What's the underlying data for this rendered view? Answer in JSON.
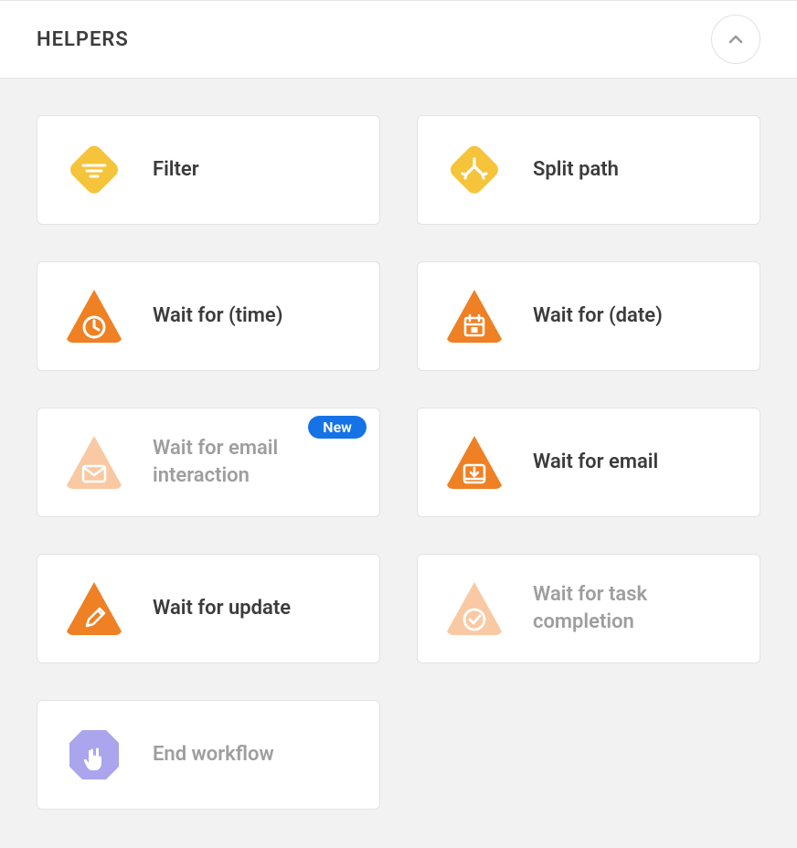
{
  "section": {
    "title": "HELPERS"
  },
  "badges": {
    "new": "New"
  },
  "cards": [
    {
      "label": "Filter"
    },
    {
      "label": "Split path"
    },
    {
      "label": "Wait for (time)"
    },
    {
      "label": "Wait for (date)"
    },
    {
      "label": "Wait for email interaction"
    },
    {
      "label": "Wait for email"
    },
    {
      "label": "Wait for update"
    },
    {
      "label": "Wait for task completion"
    },
    {
      "label": "End workflow"
    }
  ],
  "colors": {
    "diamond": "#f6c43a",
    "triangle": "#ef8023",
    "triangleMuted": "#f9c9a3",
    "hexagon": "#aaa5ec"
  }
}
